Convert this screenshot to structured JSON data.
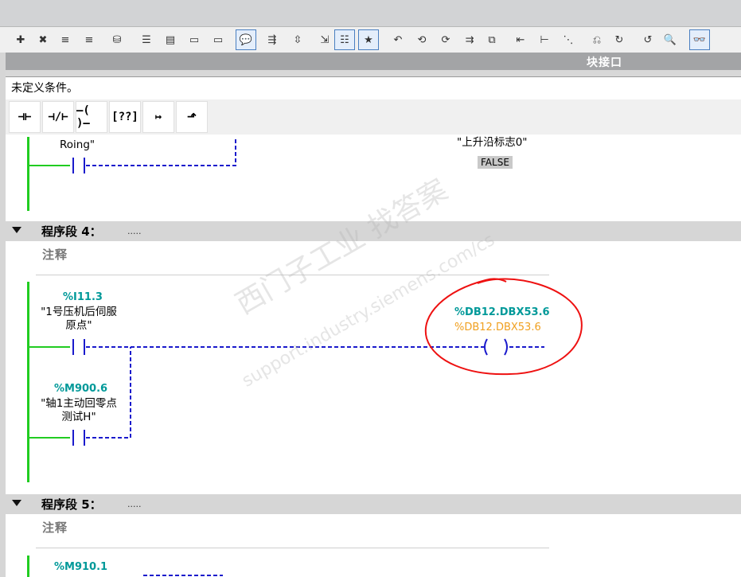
{
  "toolbar": {
    "icons": [
      "insert-network-icon",
      "delete-network-icon",
      "insert-row-icon",
      "add-row-icon",
      "clear-icon",
      "absolute-symbolic-icon",
      "network-view-icon",
      "expand-networks-icon",
      "collapse-networks-icon",
      "comment-icon",
      "expand-icon",
      "navigate-icon",
      "collapse-icon",
      "list-icon",
      "favorites-icon",
      "goto-previous-error-icon",
      "goto-next-error-icon",
      "update-icon",
      "monitor-icon",
      "compare-icon",
      "call-icon",
      "reference-icon",
      "tag-icon",
      "display-icon",
      "go-back-icon",
      "go-forward-icon",
      "find-icon",
      "monitoring-glasses-icon",
      "db-lock-icon"
    ]
  },
  "block_interface": {
    "label": "块接口"
  },
  "condition": {
    "text": "未定义条件。"
  },
  "ladder_palette": {
    "buttons": [
      {
        "name": "no-contact-button",
        "glyph": "⊣⊢"
      },
      {
        "name": "nc-contact-button",
        "glyph": "⊣/⊢"
      },
      {
        "name": "coil-button",
        "glyph": "–( )–"
      },
      {
        "name": "empty-box-button",
        "glyph": "[??]"
      },
      {
        "name": "open-branch-button",
        "glyph": "↦"
      },
      {
        "name": "close-branch-button",
        "glyph": "⬏"
      }
    ]
  },
  "network3": {
    "contact_label_tail": "Roing\"",
    "coil_label": "\"上升沿标志0\"",
    "coil_status": "FALSE"
  },
  "network4": {
    "title": "程序段 4：",
    "dots": ".....",
    "comment": "注释",
    "contact1": {
      "address": "%I11.3",
      "name": "\"1号压机后伺服\n原点\""
    },
    "contact2": {
      "address": "%M900.6",
      "name": "\"轴1主动回零点\n测试H\""
    },
    "coil": {
      "address": "%DB12.DBX53.6",
      "address_monitor": "%DB12.DBX53.6"
    }
  },
  "network5": {
    "title": "程序段 5：",
    "dots": ".....",
    "comment": "注释",
    "contact1": {
      "address": "%M910.1"
    }
  },
  "watermark": {
    "line1": "西门子工业   找答案",
    "line2": "support.industry.siemens.com/cs"
  },
  "colors": {
    "rail": "#21cc21",
    "wire": "#1a1acc",
    "address": "#009999",
    "monitor": "#f0a020",
    "annotation": "#ee1111"
  }
}
